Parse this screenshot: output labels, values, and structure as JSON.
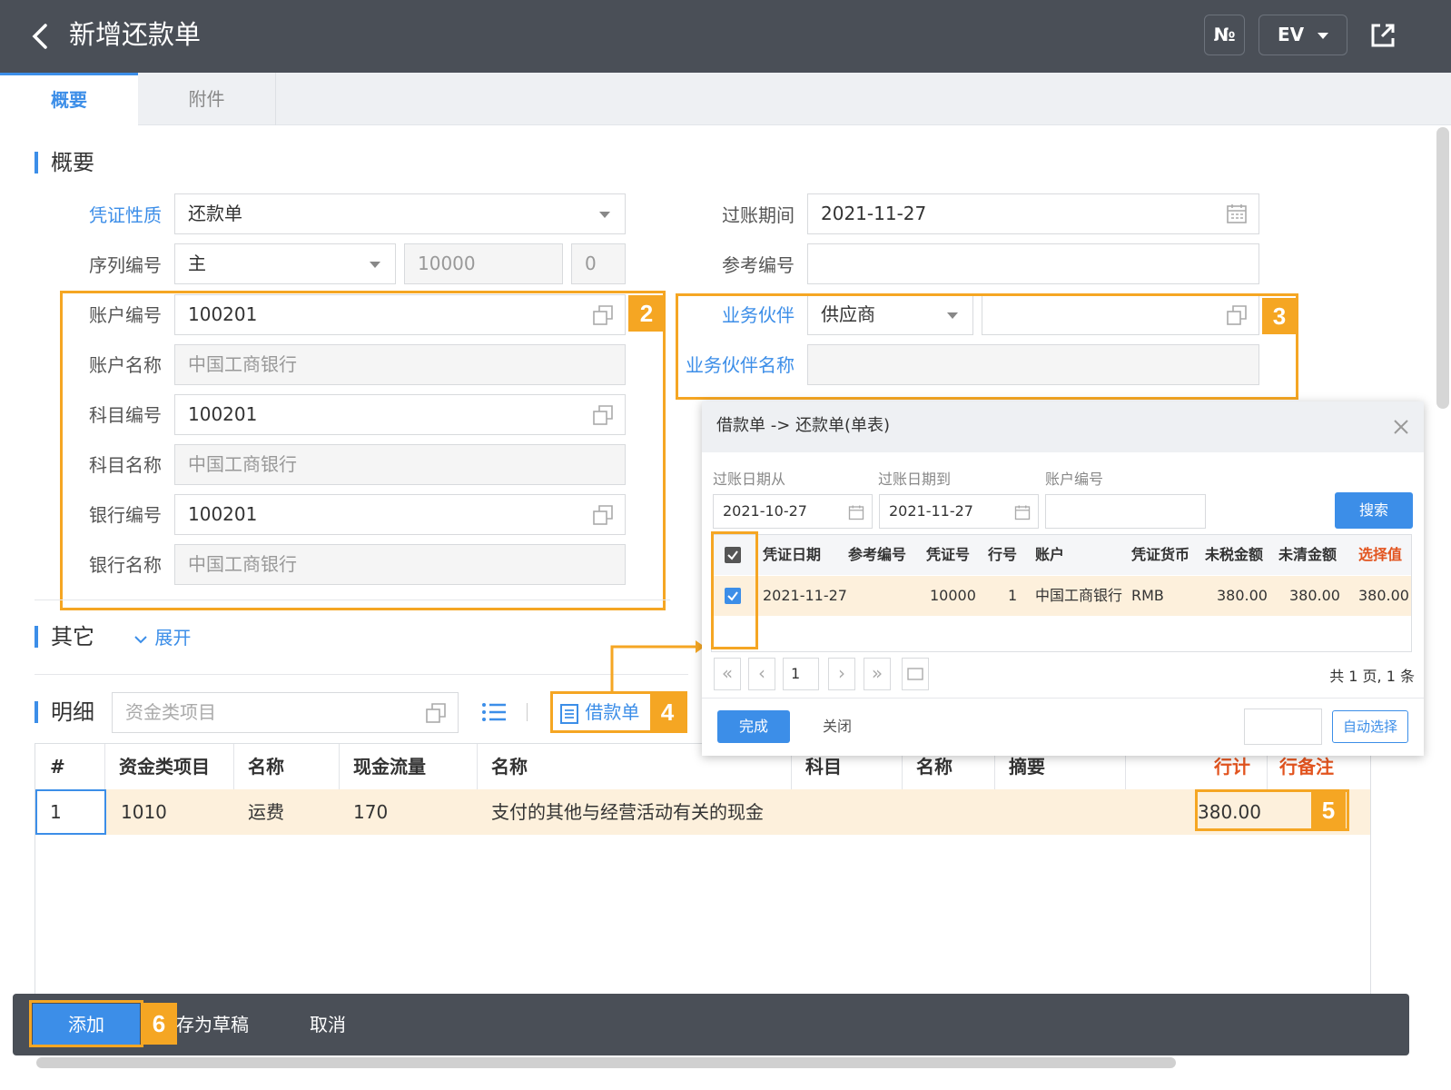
{
  "header": {
    "title": "新增还款单",
    "no_button": "N<u>o</u>",
    "no_label": "№",
    "ev_button": "EV"
  },
  "tabs": [
    {
      "label": "概要"
    },
    {
      "label": "附件"
    }
  ],
  "summary": {
    "section_title": "概要",
    "voucher_type": {
      "label": "凭证性质",
      "value": "还款单"
    },
    "serial": {
      "label": "序列编号",
      "value": "主",
      "number": "10000",
      "suffix": "0"
    },
    "posting_period": {
      "label": "过账期间",
      "value": "2021-11-27"
    },
    "reference": {
      "label": "参考编号",
      "value": ""
    },
    "account_no": {
      "label": "账户编号",
      "value": "100201"
    },
    "account_name": {
      "label": "账户名称",
      "value": "中国工商银行"
    },
    "subject_no": {
      "label": "科目编号",
      "value": "100201"
    },
    "subject_name": {
      "label": "科目名称",
      "value": "中国工商银行"
    },
    "bank_no": {
      "label": "银行编号",
      "value": "100201"
    },
    "bank_name": {
      "label": "银行名称",
      "value": "中国工商银行"
    },
    "partner": {
      "label": "业务伙伴",
      "value": "供应商",
      "code": ""
    },
    "partner_name": {
      "label": "业务伙伴名称",
      "value": ""
    }
  },
  "other": {
    "section_title": "其它",
    "expand": "展开"
  },
  "detail": {
    "section_title": "明细",
    "fund_placeholder": "资金类项目",
    "loan_button": "借款单",
    "columns": [
      "#",
      "资金类项目",
      "名称",
      "现金流量",
      "名称",
      "科目",
      "名称",
      "摘要",
      "行计",
      "行备注"
    ],
    "rows": [
      {
        "no": "1",
        "fund": "1010",
        "name": "运费",
        "cashflow": "170",
        "cf_name": "支付的其他与经营活动有关的现金",
        "amount": "380.00"
      }
    ]
  },
  "dialog": {
    "title": "借款单 -> 还款单(单表)",
    "date_from_label": "过账日期从",
    "date_from": "2021-10-27",
    "date_to_label": "过账日期到",
    "date_to": "2021-11-27",
    "account_label": "账户编号",
    "account": "",
    "search": "搜索",
    "columns": [
      "凭证日期",
      "参考编号",
      "凭证号",
      "行号",
      "账户",
      "凭证货币",
      "未税金额",
      "未清金额",
      "选择值"
    ],
    "rows": [
      {
        "date": "2021-11-27",
        "ref": "",
        "voucher": "10000",
        "line": "1",
        "account": "中国工商银行",
        "currency": "RMB",
        "pretax": "380.00",
        "open": "380.00",
        "selected": "380.00"
      }
    ],
    "page": "1",
    "page_info": "共 1 页, 1 条",
    "done": "完成",
    "close": "关闭",
    "auto_select": "自动选择"
  },
  "footer": {
    "add": "添加",
    "draft": "存为草稿",
    "cancel": "取消"
  },
  "callouts": [
    "2",
    "3",
    "4",
    "5",
    "6"
  ],
  "colors": {
    "header": "#4a4f57",
    "accent": "#3c8ee8",
    "highlight": "#f5a623",
    "row": "#fdf0dc",
    "red": "#e2541f"
  }
}
